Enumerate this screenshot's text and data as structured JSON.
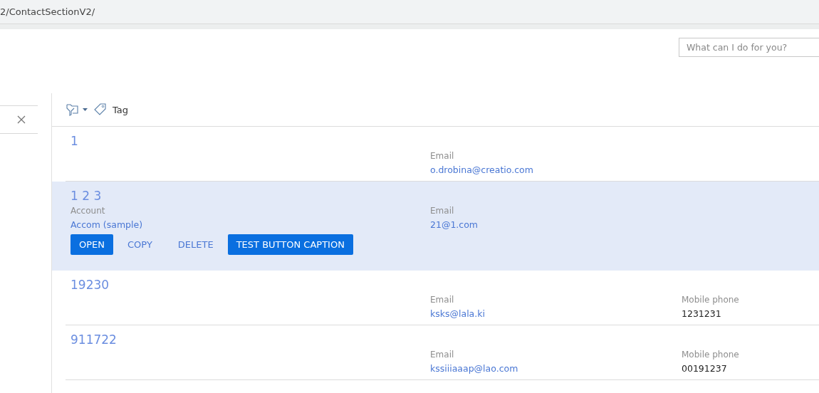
{
  "address_bar": {
    "url": "2/ContactSectionV2/"
  },
  "search": {
    "placeholder": "What can I do for you?"
  },
  "toolbar": {
    "tag_label": "Tag"
  },
  "records": [
    {
      "title": "1",
      "selected": false,
      "email_field": {
        "label": "Email",
        "value": "o.drobina@creatio.com"
      }
    },
    {
      "title": "1 2 3",
      "selected": true,
      "account_field": {
        "label": "Account",
        "value": "Accom (sample)"
      },
      "email_field": {
        "label": "Email",
        "value": "21@1.com"
      },
      "actions": [
        {
          "label": "OPEN",
          "kind": "primary"
        },
        {
          "label": "COPY",
          "kind": "flat"
        },
        {
          "label": "DELETE",
          "kind": "flat"
        },
        {
          "label": "TEST BUTTON CAPTION",
          "kind": "primary"
        }
      ]
    },
    {
      "title": "19230",
      "selected": false,
      "email_field": {
        "label": "Email",
        "value": "ksks@lala.ki"
      },
      "phone_field": {
        "label": "Mobile phone",
        "value": "1231231"
      }
    },
    {
      "title": "911722",
      "selected": false,
      "email_field": {
        "label": "Email",
        "value": "kssiiiaaap@lao.com"
      },
      "phone_field": {
        "label": "Mobile phone",
        "value": "00191237"
      }
    }
  ]
}
